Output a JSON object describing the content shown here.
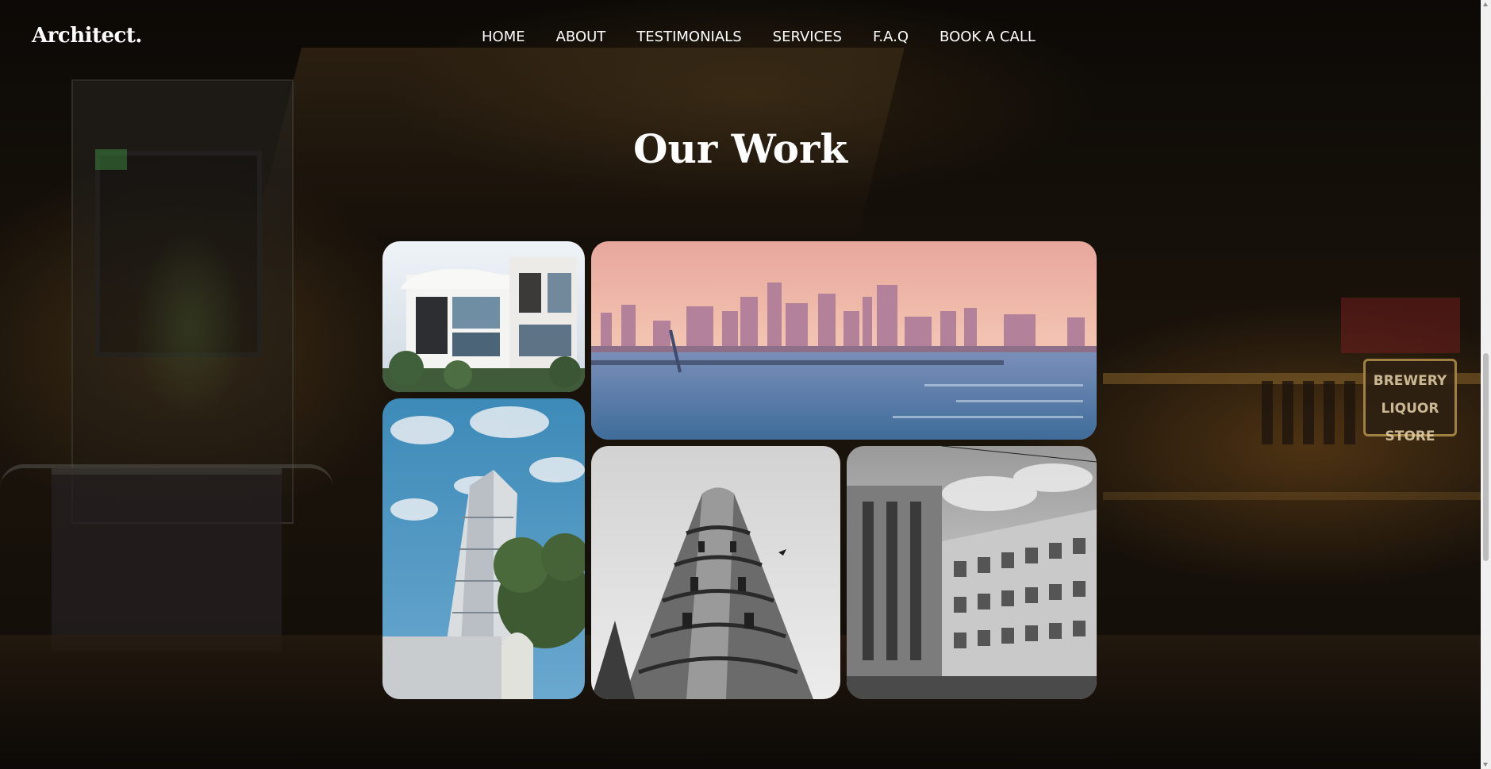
{
  "header": {
    "logo": "Architect.",
    "nav": [
      {
        "label": "HOME"
      },
      {
        "label": "ABOUT"
      },
      {
        "label": "TESTIMONIALS"
      },
      {
        "label": "SERVICES"
      },
      {
        "label": "F.A.Q"
      },
      {
        "label": "BOOK A CALL"
      }
    ]
  },
  "work_section": {
    "title": "Our Work",
    "gallery": [
      {
        "subject": "modern white house with balconies"
      },
      {
        "subject": "city skyline across water at sunset"
      },
      {
        "subject": "high-rise tower with trees and blue sky"
      },
      {
        "subject": "curved ornate building, black and white"
      },
      {
        "subject": "apartment blocks, black and white"
      }
    ]
  },
  "background_sign": {
    "line1": "BREWERY",
    "line2": "LIQUOR",
    "line3": "STORE"
  },
  "colors": {
    "text": "#ffffff",
    "background_dark": "#17110a",
    "accent_warm": "#b0782a"
  }
}
